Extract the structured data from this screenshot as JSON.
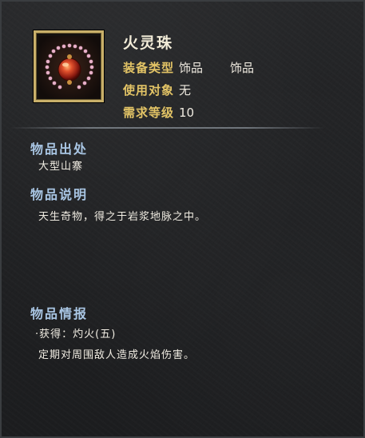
{
  "item": {
    "name": "火灵珠",
    "icon": "fire-bead-necklace-icon"
  },
  "stats": [
    {
      "label": "装备类型",
      "value": "饰品",
      "value2": "饰品"
    },
    {
      "label": "使用对象",
      "value": "无"
    },
    {
      "label": "需求等级",
      "value": "10"
    }
  ],
  "sections": {
    "source": {
      "title": "物品出处",
      "text": "大型山寨"
    },
    "description": {
      "title": "物品说明",
      "text": "天生奇物，得之于岩浆地脉之中。"
    },
    "info": {
      "title": "物品情报",
      "line1": "·获得：灼火(五)",
      "line2": "定期对周围敌人造成火焰伤害。"
    }
  },
  "colors": {
    "label": "#e3c466",
    "section_title": "#a9c6e4",
    "frame": "#c9b06a",
    "bead": "#d8452a"
  }
}
